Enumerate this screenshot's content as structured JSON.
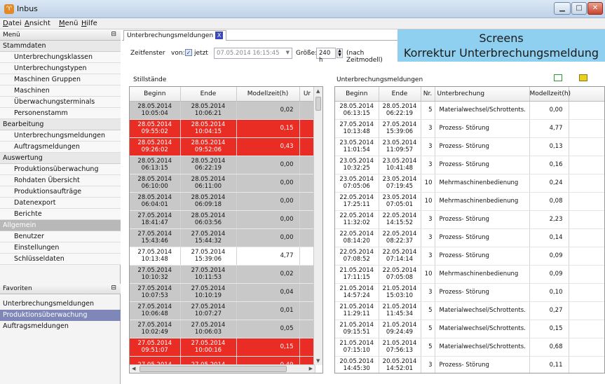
{
  "window": {
    "title": "Inbus",
    "icon": "sheep-icon",
    "buttons": [
      "minimize",
      "maximize",
      "close"
    ]
  },
  "menubar": [
    "Datei",
    "Ansicht",
    "Menü",
    "Hilfe"
  ],
  "sidebar": {
    "menu_label": "Menü",
    "groups": [
      {
        "label": "Stammdaten",
        "dark": false,
        "items": [
          "Unterbrechungsklassen",
          "Unterbrechungstypen",
          "Maschinen Gruppen",
          "Maschinen",
          "Überwachungsterminals",
          "Personenstamm"
        ]
      },
      {
        "label": "Bearbeitung",
        "dark": false,
        "items": [
          "Unterbrechungsmeldungen",
          "Auftragsmeldungen"
        ]
      },
      {
        "label": "Auswertung",
        "dark": false,
        "items": [
          "Produktionsüberwachung",
          "Rohdaten Übersicht",
          "Produktionsaufträge",
          "Datenexport",
          "Berichte"
        ]
      },
      {
        "label": "Allgemein",
        "dark": true,
        "items": [
          "Benutzer",
          "Einstellungen",
          "Schlüsseldaten"
        ]
      }
    ],
    "favorites_label": "Favoriten",
    "favorites": [
      "Unterbrechungsmeldungen",
      "Produktionsüberwachung",
      "Auftragsmeldungen"
    ],
    "selected_favorite": 1
  },
  "tab": {
    "label": "Unterbrechungsmeldungen",
    "close": "X"
  },
  "banner": {
    "line1": "Screens",
    "line2": "Korrektur Unterbrechungsmeldung"
  },
  "toolbar": {
    "zeitfenster": "Zeitfenster",
    "von": "von:",
    "jetzt": "jetzt",
    "jetzt_checked": true,
    "date": "07.05.2014 16:15:45",
    "groesse": "Größe:",
    "groesse_value": "240 h",
    "zeitmodell": "(nach Zeitmodell)"
  },
  "left_table": {
    "label": "Stillstände",
    "headers": [
      "Beginn",
      "Ende",
      "Modellzeit(h)",
      "Ur"
    ],
    "rows": [
      {
        "b": "28.05.2014",
        "bt": "10:05:04",
        "e": "28.05.2014",
        "et": "10:06:21",
        "m": "0,02",
        "style": "gray"
      },
      {
        "b": "28.05.2014",
        "bt": "09:55:02",
        "e": "28.05.2014",
        "et": "10:04:15",
        "m": "0,15",
        "style": "red"
      },
      {
        "b": "28.05.2014",
        "bt": "09:26:02",
        "e": "28.05.2014",
        "et": "09:52:06",
        "m": "0,43",
        "style": "red"
      },
      {
        "b": "28.05.2014",
        "bt": "06:13:15",
        "e": "28.05.2014",
        "et": "06:22:19",
        "m": "0,00",
        "style": "gray"
      },
      {
        "b": "28.05.2014",
        "bt": "06:10:00",
        "e": "28.05.2014",
        "et": "06:11:00",
        "m": "0,00",
        "style": "gray"
      },
      {
        "b": "28.05.2014",
        "bt": "06:04:01",
        "e": "28.05.2014",
        "et": "06:09:18",
        "m": "0,00",
        "style": "gray"
      },
      {
        "b": "27.05.2014",
        "bt": "18:41:47",
        "e": "28.05.2014",
        "et": "06:03:56",
        "m": "0,00",
        "style": "gray"
      },
      {
        "b": "27.05.2014",
        "bt": "15:43:46",
        "e": "27.05.2014",
        "et": "15:44:32",
        "m": "0,00",
        "style": "gray"
      },
      {
        "b": "27.05.2014",
        "bt": "10:13:48",
        "e": "27.05.2014",
        "et": "15:39:06",
        "m": "4,77",
        "style": "white"
      },
      {
        "b": "27.05.2014",
        "bt": "10:10:32",
        "e": "27.05.2014",
        "et": "10:11:53",
        "m": "0,02",
        "style": "gray"
      },
      {
        "b": "27.05.2014",
        "bt": "10:07:53",
        "e": "27.05.2014",
        "et": "10:10:19",
        "m": "0,04",
        "style": "gray"
      },
      {
        "b": "27.05.2014",
        "bt": "10:06:48",
        "e": "27.05.2014",
        "et": "10:07:27",
        "m": "0,01",
        "style": "gray"
      },
      {
        "b": "27.05.2014",
        "bt": "10:02:49",
        "e": "27.05.2014",
        "et": "10:06:03",
        "m": "0,05",
        "style": "gray"
      },
      {
        "b": "27.05.2014",
        "bt": "09:51:07",
        "e": "27.05.2014",
        "et": "10:00:16",
        "m": "0,15",
        "style": "red"
      },
      {
        "b": "27.05.2014",
        "bt": "",
        "e": "27.05.2014",
        "et": "",
        "m": "0,49",
        "style": "red"
      }
    ]
  },
  "right_table": {
    "label": "Unterbrechungsmeldungen",
    "headers": [
      "Beginn",
      "Ende",
      "Nr.",
      "Unterbrechung",
      "Modellzeit(h)"
    ],
    "rows": [
      {
        "b": "28.05.2014",
        "bt": "06:13:15",
        "e": "28.05.2014",
        "et": "06:22:19",
        "nr": "5",
        "u": "Materialwechsel/Schrottents.",
        "m": "0,00"
      },
      {
        "b": "27.05.2014",
        "bt": "10:13:48",
        "e": "27.05.2014",
        "et": "15:39:06",
        "nr": "3",
        "u": "Prozess- Störung",
        "m": "4,77"
      },
      {
        "b": "23.05.2014",
        "bt": "11:01:54",
        "e": "23.05.2014",
        "et": "11:09:57",
        "nr": "3",
        "u": "Prozess- Störung",
        "m": "0,13"
      },
      {
        "b": "23.05.2014",
        "bt": "10:32:25",
        "e": "23.05.2014",
        "et": "10:41:48",
        "nr": "3",
        "u": "Prozess- Störung",
        "m": "0,16"
      },
      {
        "b": "23.05.2014",
        "bt": "07:05:06",
        "e": "23.05.2014",
        "et": "07:19:45",
        "nr": "10",
        "u": "Mehrmaschinenbedienung",
        "m": "0,24"
      },
      {
        "b": "22.05.2014",
        "bt": "17:25:11",
        "e": "23.05.2014",
        "et": "07:05:01",
        "nr": "10",
        "u": "Mehrmaschinenbedienung",
        "m": "0,08"
      },
      {
        "b": "22.05.2014",
        "bt": "11:32:02",
        "e": "22.05.2014",
        "et": "14:15:52",
        "nr": "3",
        "u": "Prozess- Störung",
        "m": "2,23"
      },
      {
        "b": "22.05.2014",
        "bt": "08:14:20",
        "e": "22.05.2014",
        "et": "08:22:37",
        "nr": "3",
        "u": "Prozess- Störung",
        "m": "0,14"
      },
      {
        "b": "22.05.2014",
        "bt": "07:08:52",
        "e": "22.05.2014",
        "et": "07:14:14",
        "nr": "3",
        "u": "Prozess- Störung",
        "m": "0,09"
      },
      {
        "b": "21.05.2014",
        "bt": "17:11:15",
        "e": "22.05.2014",
        "et": "07:05:08",
        "nr": "10",
        "u": "Mehrmaschinenbedienung",
        "m": "0,09"
      },
      {
        "b": "21.05.2014",
        "bt": "14:57:24",
        "e": "21.05.2014",
        "et": "15:03:10",
        "nr": "3",
        "u": "Prozess- Störung",
        "m": "0,10"
      },
      {
        "b": "21.05.2014",
        "bt": "11:29:11",
        "e": "21.05.2014",
        "et": "11:45:34",
        "nr": "5",
        "u": "Materialwechsel/Schrottents.",
        "m": "0,27"
      },
      {
        "b": "21.05.2014",
        "bt": "09:15:51",
        "e": "21.05.2014",
        "et": "09:24:49",
        "nr": "5",
        "u": "Materialwechsel/Schrottents.",
        "m": "0,15"
      },
      {
        "b": "21.05.2014",
        "bt": "07:15:10",
        "e": "21.05.2014",
        "et": "07:56:13",
        "nr": "5",
        "u": "Materialwechsel/Schrottents.",
        "m": "0,68"
      },
      {
        "b": "20.05.2014",
        "bt": "14:45:30",
        "e": "20.05.2014",
        "et": "14:52:01",
        "nr": "3",
        "u": "Prozess- Störung",
        "m": "0,11"
      }
    ]
  },
  "colors": {
    "red": "#ea2d24",
    "gray": "#c8c8c8",
    "banner": "#8fd0f0",
    "selected": "#7f86b8"
  }
}
